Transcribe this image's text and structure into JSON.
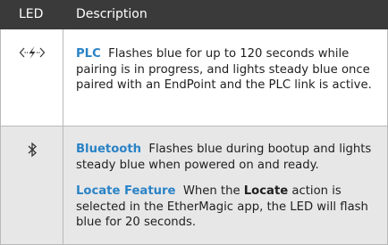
{
  "table": {
    "headers": {
      "led": "LED",
      "description": "Description"
    },
    "rows": [
      {
        "icon": "plc-link-icon",
        "term": "PLC",
        "text": "Flashes blue for up to 120 seconds while pairing is in progress, and lights steady blue once paired with an EndPoint and the PLC link is active."
      },
      {
        "icon": "bluetooth-icon",
        "term": "Bluetooth",
        "text": "Flashes blue during bootup and lights steady blue when powered on and ready.",
        "extra_term": "Locate Feature",
        "extra_text_a": "When the",
        "extra_bold": "Locate",
        "extra_text_b": "action is selected in the EtherMagic app, the LED will flash blue for 20 seconds."
      }
    ]
  },
  "colors": {
    "header_bg": "#3a3a3a",
    "accent": "#2a83c6",
    "alt_row_bg": "#e7e7e8",
    "border": "#b9b9b9"
  }
}
